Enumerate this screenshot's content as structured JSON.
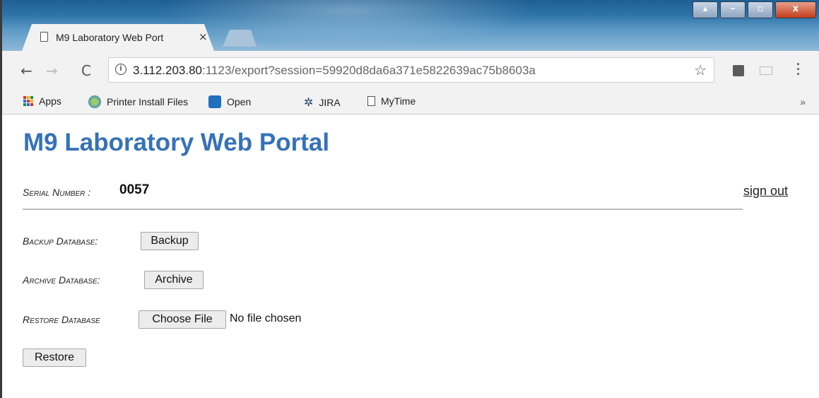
{
  "browser": {
    "tab_title": "M9 Laboratory Web Port",
    "tab_close": "×",
    "url_host": "3.112.203.80",
    "url_rest": ":1123/export?session=59920d8da6a371e5822639ac75b8603a",
    "window_controls": [
      "▴",
      "–",
      "▫",
      "x"
    ],
    "bookmarks": [
      "Apps",
      "Printer Install Files",
      "Open",
      "JIRA",
      "MyTime"
    ],
    "bookmarks_more": "»"
  },
  "page": {
    "title": "M9 Laboratory Web Portal",
    "serial_label": "Serial Number :",
    "serial_value": "0057",
    "sign_out": "sign out",
    "backup_label": "Backup Database:",
    "backup_button": "Backup",
    "archive_label": "Archive Database:",
    "archive_button": "Archive",
    "restore_label": "Restore Database",
    "choose_file_button": "Choose File",
    "file_status": "No file chosen",
    "restore_button": "Restore"
  },
  "colors": {
    "title": "#3572b8",
    "titlebar": "#2e74a8",
    "close_button": "#c23d1c"
  }
}
